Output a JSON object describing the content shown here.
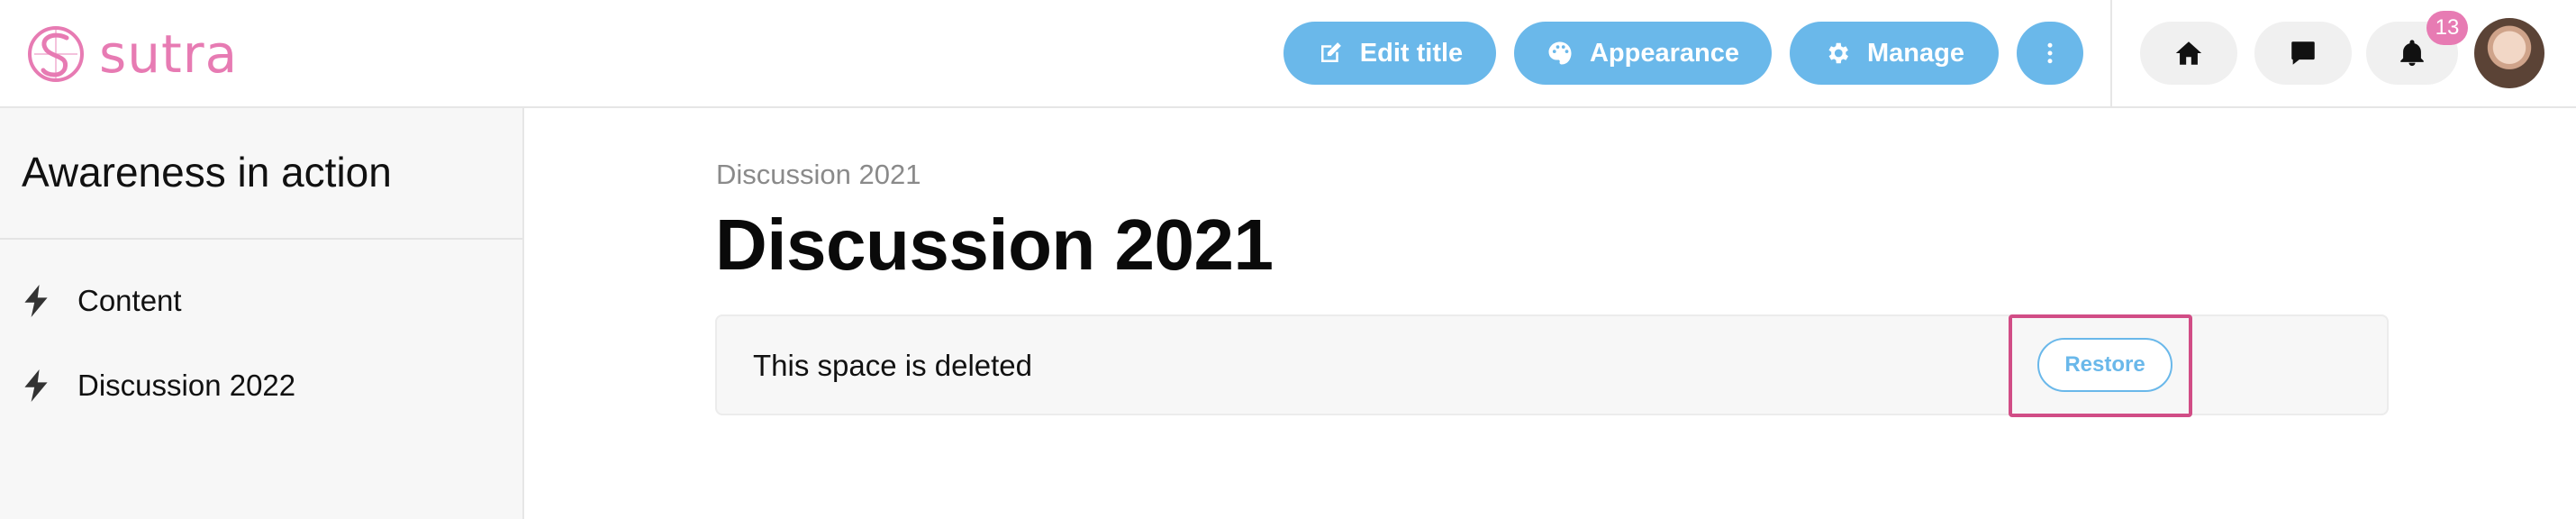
{
  "brand": {
    "name": "sutra",
    "color": "#e77bb3"
  },
  "toolbar": {
    "edit_title": "Edit title",
    "appearance": "Appearance",
    "manage": "Manage",
    "accent_color": "#6ab8ea"
  },
  "icons": {
    "edit": "pencil-square-icon",
    "appearance": "palette-icon",
    "manage": "gear-icon",
    "more": "vertical-ellipsis-icon",
    "home": "home-icon",
    "messages": "chat-bubble-icon",
    "notifications": "bell-icon",
    "sidebar_item": "lightning-bolt-icon"
  },
  "notifications": {
    "count": "13"
  },
  "sidebar": {
    "title": "Awareness in action",
    "items": [
      {
        "label": "Content"
      },
      {
        "label": "Discussion 2022"
      }
    ]
  },
  "main": {
    "breadcrumb": "Discussion 2021",
    "title": "Discussion 2021",
    "notice": "This space is deleted",
    "restore_label": "Restore",
    "highlight_color": "#d14d86"
  }
}
